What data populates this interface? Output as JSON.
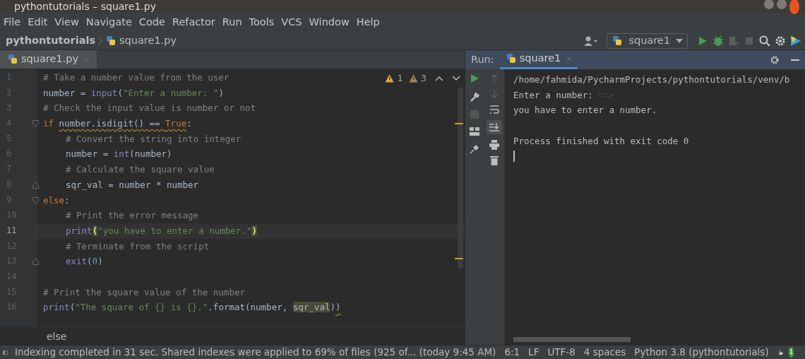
{
  "window": {
    "title": "pythontutorials – square1.py"
  },
  "menu": [
    "File",
    "Edit",
    "View",
    "Navigate",
    "Code",
    "Refactor",
    "Run",
    "Tools",
    "VCS",
    "Window",
    "Help"
  ],
  "breadcrumb": [
    "pythontutorials",
    "square1.py"
  ],
  "run_config": {
    "label": "square1"
  },
  "editor_tabs": [
    {
      "label": "square1.py",
      "selected": true
    }
  ],
  "inspections": [
    {
      "kind": "warning",
      "count": "1"
    },
    {
      "kind": "weak",
      "count": "3"
    }
  ],
  "lines": [
    {
      "number": "1",
      "current": false,
      "indented": false,
      "tokens": [
        {
          "text": "# Take a number value from the user",
          "kind": "comment"
        }
      ]
    },
    {
      "number": "2",
      "current": false,
      "indented": false,
      "tokens": [
        {
          "text": "number = ",
          "kind": "plain"
        },
        {
          "text": "input",
          "kind": "builtin"
        },
        {
          "text": "(",
          "kind": "plain"
        },
        {
          "text": "\"Enter a number: \"",
          "kind": "string"
        },
        {
          "text": ")",
          "kind": "plain"
        }
      ]
    },
    {
      "number": "3",
      "current": false,
      "indented": false,
      "tokens": [
        {
          "text": "# Check the input value is number or not",
          "kind": "comment"
        }
      ]
    },
    {
      "number": "4",
      "current": false,
      "indented": false,
      "kind": "fold-start",
      "tokens": [
        {
          "text": "if ",
          "kind": "keyword"
        },
        {
          "text": "number.isdigit() == ",
          "kind": "warn"
        },
        {
          "text": "True",
          "kind": "warn-keyword"
        },
        {
          "text": ":",
          "kind": "plain"
        }
      ]
    },
    {
      "number": "5",
      "current": false,
      "indented": true,
      "tokens": [
        {
          "text": "# Convert the string into integer",
          "kind": "comment"
        }
      ]
    },
    {
      "number": "6",
      "current": false,
      "indented": true,
      "tokens": [
        {
          "text": "number = ",
          "kind": "plain"
        },
        {
          "text": "int",
          "kind": "builtin"
        },
        {
          "text": "(number)",
          "kind": "plain"
        }
      ]
    },
    {
      "number": "7",
      "current": false,
      "indented": true,
      "tokens": [
        {
          "text": "# Calculate the square value",
          "kind": "comment"
        }
      ]
    },
    {
      "number": "8",
      "current": false,
      "indented": true,
      "kind": "fold-end",
      "tokens": [
        {
          "text": "sqr_val = number * number",
          "kind": "plain"
        }
      ]
    },
    {
      "number": "9",
      "current": false,
      "indented": false,
      "kind": "fold-start",
      "tokens": [
        {
          "text": "else",
          "kind": "keyword"
        },
        {
          "text": ":",
          "kind": "plain"
        }
      ]
    },
    {
      "number": "10",
      "current": false,
      "indented": true,
      "tokens": [
        {
          "text": "# Print the error message",
          "kind": "comment"
        }
      ]
    },
    {
      "number": "11",
      "current": true,
      "indented": true,
      "tokens": [
        {
          "text": "print",
          "kind": "builtin"
        },
        {
          "text": "(",
          "kind": "brace-match"
        },
        {
          "text": "\"you have to enter a number.\"",
          "kind": "string"
        },
        {
          "text": ")",
          "kind": "brace-match"
        }
      ]
    },
    {
      "number": "12",
      "current": false,
      "indented": true,
      "tokens": [
        {
          "text": "# Terminate from the script",
          "kind": "comment"
        }
      ]
    },
    {
      "number": "13",
      "current": false,
      "indented": true,
      "kind": "fold-end",
      "tokens": [
        {
          "text": "exit",
          "kind": "builtin"
        },
        {
          "text": "(",
          "kind": "plain"
        },
        {
          "text": "0",
          "kind": "number"
        },
        {
          "text": ")",
          "kind": "plain"
        }
      ]
    },
    {
      "number": "14",
      "current": false,
      "kind": "plain"
    },
    {
      "number": "15",
      "current": false,
      "indented": false,
      "tokens": [
        {
          "text": "# Print the square value of the number",
          "kind": "comment"
        }
      ]
    },
    {
      "number": "16",
      "current": false,
      "indented": false,
      "tokens": [
        {
          "text": "print",
          "kind": "builtin"
        },
        {
          "text": "(",
          "kind": "plain"
        },
        {
          "text": "\"The square of {} is {}.\"",
          "kind": "string"
        },
        {
          "text": ".format(number, ",
          "kind": "plain"
        },
        {
          "text": "sqr_val",
          "kind": "highlight"
        },
        {
          "text": ")",
          "kind": "plain"
        },
        {
          "text": ")",
          "kind": "warn"
        }
      ]
    }
  ],
  "code_breadcrumb": "else",
  "run_panel": {
    "title": "Run:",
    "tabs": [
      {
        "label": "square1",
        "selected": true
      }
    ],
    "console": [
      {
        "text": "/home/fahmida/PycharmProjects/pythontutorials/venv/b",
        "kind": "output"
      },
      {
        "text": "Enter a number: ",
        "kind": "prompt"
      },
      {
        "text": "you have to enter a number.",
        "kind": "output"
      },
      {
        "text": "Process finished with exit code 0",
        "kind": "exit"
      }
    ]
  },
  "status_bar": {
    "message": "Indexing completed in 31 sec. Shared indexes were applied to 69% of files (925 of... (today 9:45 AM)",
    "items": [
      "6:1",
      "LF",
      "UTF-8",
      "4 spaces",
      "Python 3.8 (pythontutorials)"
    ],
    "notifications": "1"
  }
}
